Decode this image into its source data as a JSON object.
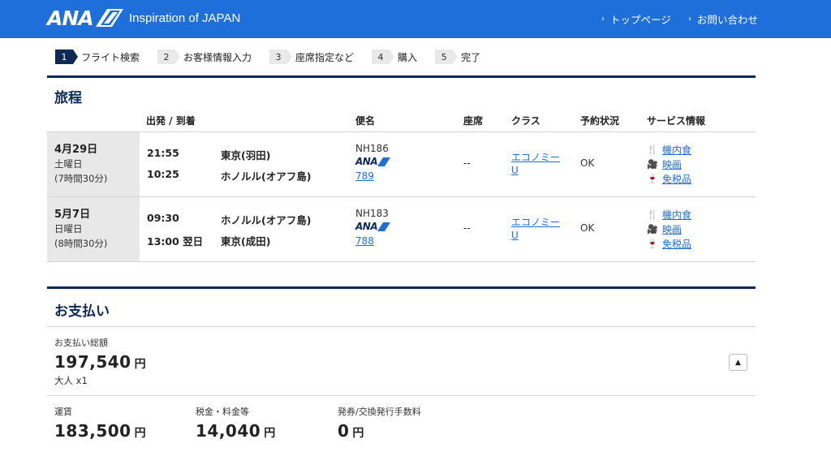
{
  "header": {
    "logo_text": "ANA",
    "tagline": "Inspiration of JAPAN",
    "links": [
      "トップページ",
      "お問い合わせ"
    ],
    "bg_color": "#1e6fd9"
  },
  "steps": [
    {
      "num": "1",
      "label": "フライト検索",
      "active": true
    },
    {
      "num": "2",
      "label": "お客様情報入力",
      "active": false
    },
    {
      "num": "3",
      "label": "座席指定など",
      "active": false
    },
    {
      "num": "4",
      "label": "購入",
      "active": false
    },
    {
      "num": "5",
      "label": "完了",
      "active": false
    }
  ],
  "itinerary": {
    "title": "旅程",
    "columns": {
      "dep_arr": "出発 / 到着",
      "flight": "便名",
      "seat": "座席",
      "class": "クラス",
      "status": "予約状況",
      "services": "サービス情報"
    },
    "flights": [
      {
        "date": "4月29日",
        "weekday": "土曜日",
        "duration": "(7時間30分)",
        "dep_time": "21:55",
        "dep_place": "東京(羽田)",
        "arr_time": "10:25",
        "arr_place": "ホノルル(オアフ島)",
        "flight_no": "NH186",
        "airline_logo": "ANA",
        "aircraft": "789",
        "seat": "--",
        "class_name": "エコノミー",
        "class_code": "U",
        "status": "OK",
        "services": [
          {
            "icon": "meal-icon",
            "label": "機内食"
          },
          {
            "icon": "movie-icon",
            "label": "映画"
          },
          {
            "icon": "duty-free-icon",
            "label": "免税品"
          }
        ]
      },
      {
        "date": "5月7日",
        "weekday": "日曜日",
        "duration": "(8時間30分)",
        "dep_time": "09:30",
        "dep_place": "ホノルル(オアフ島)",
        "arr_time": "13:00 翌日",
        "arr_place": "東京(成田)",
        "flight_no": "NH183",
        "airline_logo": "ANA",
        "aircraft": "788",
        "seat": "--",
        "class_name": "エコノミー",
        "class_code": "U",
        "status": "OK",
        "services": [
          {
            "icon": "meal-icon",
            "label": "機内食"
          },
          {
            "icon": "movie-icon",
            "label": "映画"
          },
          {
            "icon": "duty-free-icon",
            "label": "免税品"
          }
        ]
      }
    ]
  },
  "payment": {
    "title": "お支払い",
    "total_label": "お支払い総額",
    "total_amount": "197,540",
    "currency": "円",
    "passengers": "大人 x1",
    "breakdown": [
      {
        "label": "運賃",
        "amount": "183,500"
      },
      {
        "label": "税金・料金等",
        "amount": "14,040"
      },
      {
        "label": "発券/交換発行手数料",
        "amount": "0"
      }
    ]
  }
}
